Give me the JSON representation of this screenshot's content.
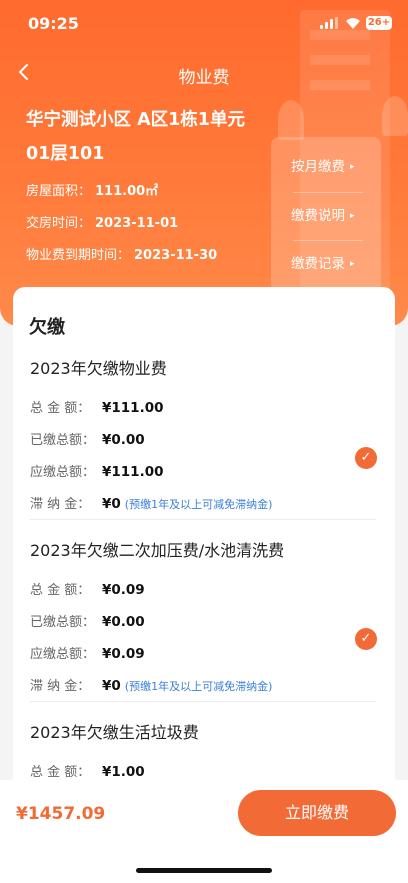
{
  "status_bar": {
    "time": "09:25",
    "battery": "26+"
  },
  "nav": {
    "back_icon": "chevron-left-icon",
    "title": "物业费"
  },
  "property": {
    "address": "华宁测试小区 A区1栋1单元01层101",
    "area_label": "房屋面积：",
    "area_value": "111.00㎡",
    "handover_label": "交房时间：",
    "handover_value": "2023-11-01",
    "expire_label": "物业费到期时间：",
    "expire_value": "2023-11-30"
  },
  "side_menu": [
    {
      "label": "按月缴费"
    },
    {
      "label": "缴费说明"
    },
    {
      "label": "缴费记录"
    }
  ],
  "section_title": "欠缴",
  "fee_groups": [
    {
      "title": "2023年欠缴物业费",
      "rows": [
        {
          "label": "总 金 额：",
          "value": "¥111.00"
        },
        {
          "label": "已缴总额：",
          "value": "¥0.00"
        },
        {
          "label": "应缴总额：",
          "value": "¥111.00"
        },
        {
          "label": "滞 纳 金：",
          "value": "¥0",
          "note": "(预缴1年及以上可减免滞纳金)"
        }
      ],
      "checked": true
    },
    {
      "title": "2023年欠缴二次加压费/水池清洗费",
      "rows": [
        {
          "label": "总 金 额：",
          "value": "¥0.09"
        },
        {
          "label": "已缴总额：",
          "value": "¥0.00"
        },
        {
          "label": "应缴总额：",
          "value": "¥0.09"
        },
        {
          "label": "滞 纳 金：",
          "value": "¥0",
          "note": "(预缴1年及以上可减免滞纳金)"
        }
      ],
      "checked": true
    },
    {
      "title": "2023年欠缴生活垃圾费",
      "rows": [
        {
          "label": "总 金 额：",
          "value": "¥1.00"
        }
      ],
      "checked": false
    }
  ],
  "footer": {
    "total": "¥1457.09",
    "pay_button": "立即缴费"
  },
  "colors": {
    "accent": "#f26a35",
    "header": "#ff6a2e",
    "note": "#3b7fd6"
  }
}
